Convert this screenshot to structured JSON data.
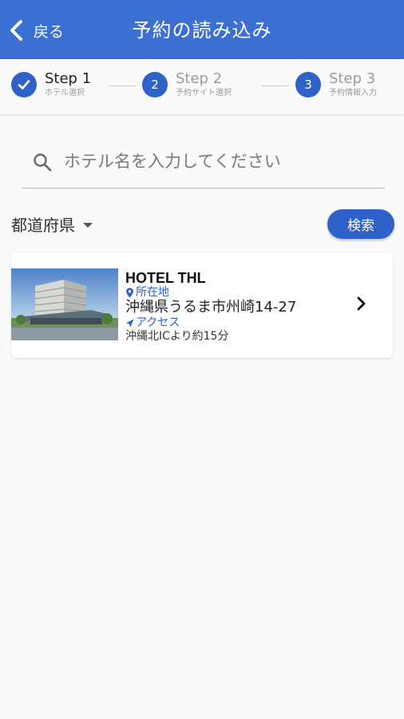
{
  "appbar": {
    "back_label": "戻る",
    "title": "予約の読み込み"
  },
  "stepper": {
    "steps": [
      {
        "number": "1",
        "title": "Step 1",
        "subtitle": "ホテル選択"
      },
      {
        "number": "2",
        "title": "Step 2",
        "subtitle": "予約サイト選択"
      },
      {
        "number": "3",
        "title": "Step 3",
        "subtitle": "予約情報入力"
      }
    ]
  },
  "search": {
    "placeholder": "ホテル名を入力してください",
    "value": ""
  },
  "filter": {
    "prefecture_label": "都道府県",
    "search_button": "検索"
  },
  "hotels": [
    {
      "name": "HOTEL THL",
      "location_label": "所在地",
      "address": "沖縄県うるま市州崎14-27",
      "access_label": "アクセス",
      "access": "沖縄北ICより約15分"
    }
  ],
  "icons": {
    "back": "chevron-left-icon",
    "done": "check-icon",
    "search": "search-icon",
    "location": "map-pin-icon",
    "access": "navigation-arrow-icon",
    "open": "chevron-right-icon"
  },
  "colors": {
    "primary": "#3b6fd1",
    "accent": "#2f62c9",
    "background": "#fafafa"
  }
}
